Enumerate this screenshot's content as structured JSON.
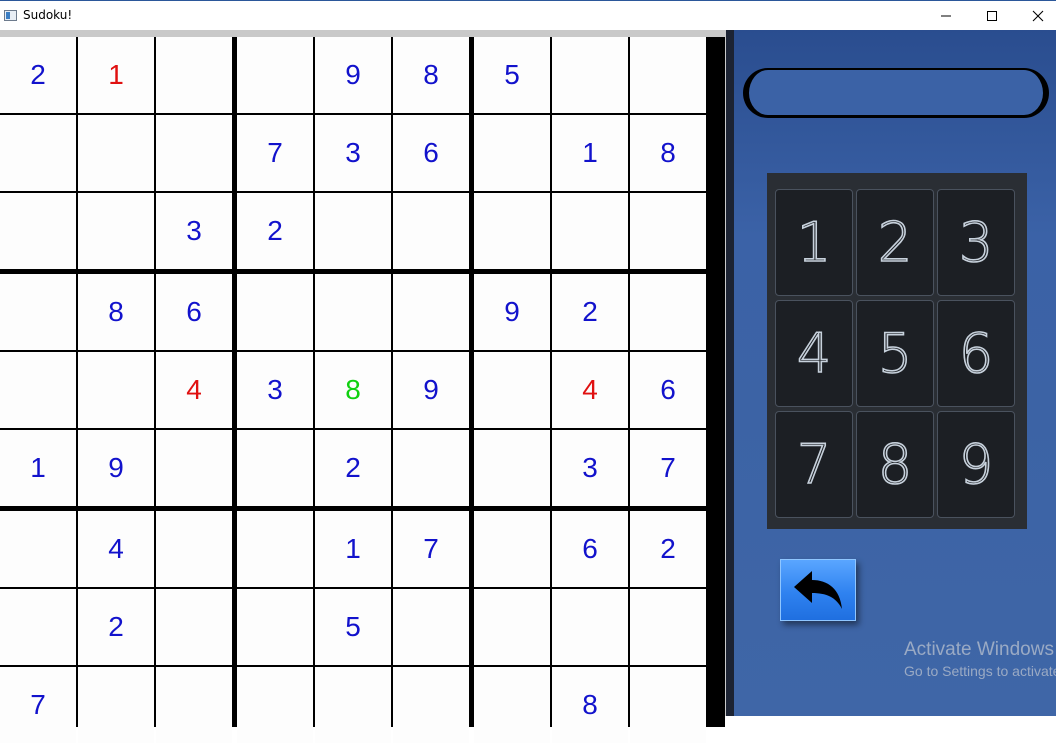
{
  "window": {
    "title": "Sudoku!",
    "controls": {
      "minimize": "minimize-icon",
      "maximize": "maximize-icon",
      "close": "close-icon"
    }
  },
  "colors": {
    "given": "#1212cc",
    "error": "#e01010",
    "correct": "#10d010",
    "grid_line": "#000000",
    "cell_bg": "#fdfdfd",
    "panel_bg": "#3b62a6",
    "keypad_bg": "#2a2e34"
  },
  "board": {
    "visible_rows": 9,
    "visible_cols": 9,
    "cells": [
      [
        {
          "v": "2",
          "c": "given"
        },
        {
          "v": "1",
          "c": "error"
        },
        {
          "v": "",
          "c": ""
        },
        {
          "v": "",
          "c": ""
        },
        {
          "v": "9",
          "c": "given"
        },
        {
          "v": "8",
          "c": "given"
        },
        {
          "v": "5",
          "c": "given"
        },
        {
          "v": "",
          "c": ""
        },
        {
          "v": "",
          "c": ""
        }
      ],
      [
        {
          "v": "",
          "c": ""
        },
        {
          "v": "",
          "c": ""
        },
        {
          "v": "",
          "c": ""
        },
        {
          "v": "7",
          "c": "given"
        },
        {
          "v": "3",
          "c": "given"
        },
        {
          "v": "6",
          "c": "given"
        },
        {
          "v": "",
          "c": ""
        },
        {
          "v": "1",
          "c": "given"
        },
        {
          "v": "8",
          "c": "given"
        }
      ],
      [
        {
          "v": "",
          "c": ""
        },
        {
          "v": "",
          "c": ""
        },
        {
          "v": "3",
          "c": "given"
        },
        {
          "v": "2",
          "c": "given"
        },
        {
          "v": "",
          "c": ""
        },
        {
          "v": "",
          "c": ""
        },
        {
          "v": "",
          "c": ""
        },
        {
          "v": "",
          "c": ""
        },
        {
          "v": "",
          "c": ""
        }
      ],
      [
        {
          "v": "",
          "c": ""
        },
        {
          "v": "8",
          "c": "given"
        },
        {
          "v": "6",
          "c": "given"
        },
        {
          "v": "",
          "c": ""
        },
        {
          "v": "",
          "c": ""
        },
        {
          "v": "",
          "c": ""
        },
        {
          "v": "9",
          "c": "given"
        },
        {
          "v": "2",
          "c": "given"
        },
        {
          "v": "",
          "c": ""
        }
      ],
      [
        {
          "v": "",
          "c": ""
        },
        {
          "v": "",
          "c": ""
        },
        {
          "v": "4",
          "c": "error"
        },
        {
          "v": "3",
          "c": "given"
        },
        {
          "v": "8",
          "c": "correct"
        },
        {
          "v": "9",
          "c": "given"
        },
        {
          "v": "",
          "c": ""
        },
        {
          "v": "4",
          "c": "error"
        },
        {
          "v": "6",
          "c": "given"
        }
      ],
      [
        {
          "v": "1",
          "c": "given"
        },
        {
          "v": "9",
          "c": "given"
        },
        {
          "v": "",
          "c": ""
        },
        {
          "v": "",
          "c": ""
        },
        {
          "v": "2",
          "c": "given"
        },
        {
          "v": "",
          "c": ""
        },
        {
          "v": "",
          "c": ""
        },
        {
          "v": "3",
          "c": "given"
        },
        {
          "v": "7",
          "c": "given"
        }
      ],
      [
        {
          "v": "",
          "c": ""
        },
        {
          "v": "4",
          "c": "given"
        },
        {
          "v": "",
          "c": ""
        },
        {
          "v": "",
          "c": ""
        },
        {
          "v": "1",
          "c": "given"
        },
        {
          "v": "7",
          "c": "given"
        },
        {
          "v": "",
          "c": ""
        },
        {
          "v": "6",
          "c": "given"
        },
        {
          "v": "2",
          "c": "given"
        }
      ],
      [
        {
          "v": "",
          "c": ""
        },
        {
          "v": "2",
          "c": "given"
        },
        {
          "v": "",
          "c": ""
        },
        {
          "v": "",
          "c": ""
        },
        {
          "v": "5",
          "c": "given"
        },
        {
          "v": "",
          "c": ""
        },
        {
          "v": "",
          "c": ""
        },
        {
          "v": "",
          "c": ""
        },
        {
          "v": "",
          "c": ""
        }
      ],
      [
        {
          "v": "7",
          "c": "given"
        },
        {
          "v": "",
          "c": ""
        },
        {
          "v": "",
          "c": ""
        },
        {
          "v": "",
          "c": ""
        },
        {
          "v": "",
          "c": ""
        },
        {
          "v": "",
          "c": ""
        },
        {
          "v": "",
          "c": ""
        },
        {
          "v": "8",
          "c": "given"
        },
        {
          "v": "",
          "c": ""
        }
      ]
    ]
  },
  "status_field": {
    "value": ""
  },
  "keypad": {
    "keys": [
      "1",
      "2",
      "3",
      "4",
      "5",
      "6",
      "7",
      "8",
      "9"
    ]
  },
  "undo_button": {
    "icon": "undo-arrow-icon"
  },
  "watermark": {
    "line1": "Activate Windows",
    "line2": "Go to Settings to activate Windows."
  }
}
